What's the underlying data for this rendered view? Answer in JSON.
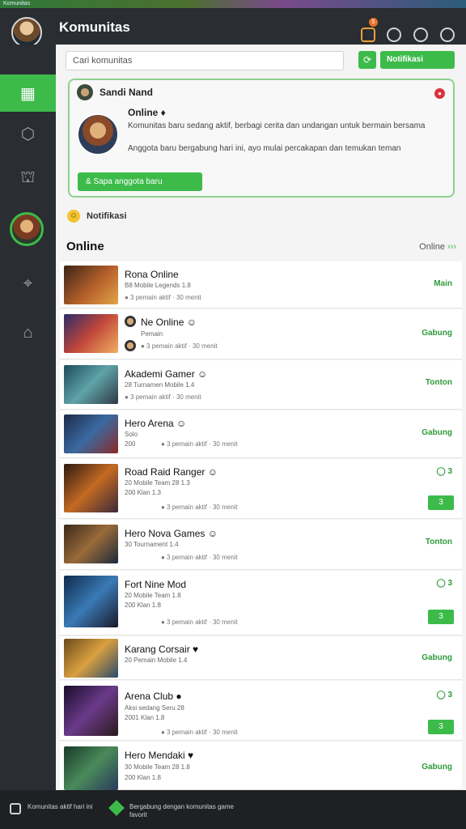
{
  "topbar": {
    "label": "Komunitas"
  },
  "header": {
    "title": "Komunitas",
    "notif_count": "5",
    "icons": [
      "notification-icon",
      "clock-icon",
      "chat-icon",
      "settings-icon"
    ]
  },
  "sidebar": {
    "items": [
      {
        "icon": "grid-icon",
        "glyph": "▦"
      },
      {
        "icon": "shield-icon",
        "glyph": "⬡"
      },
      {
        "icon": "map-icon",
        "glyph": "⛫"
      },
      {
        "icon": "avatar",
        "glyph": ""
      },
      {
        "icon": "crosshair-icon",
        "glyph": "⌖"
      },
      {
        "icon": "home-icon",
        "glyph": "⌂"
      }
    ]
  },
  "search": {
    "value": "Cari komunitas"
  },
  "buttons": {
    "refresh_glyph": "⟳",
    "notif_label": "Notifikasi"
  },
  "profile_card": {
    "name": "Sandi Nand",
    "status": "Online ♦",
    "text1": "Komunitas baru sedang aktif, berbagi cerita dan undangan untuk bermain bersama",
    "text2": "Anggota baru bergabung hari ini, ayo mulai percakapan dan temukan teman",
    "action": "& Sapa anggota baru",
    "close": "●"
  },
  "notice": {
    "emoji": "☺",
    "text": "Notifikasi"
  },
  "section": {
    "title": "Online",
    "link": "Online",
    "link_arrow": "›››"
  },
  "games": [
    {
      "title": "Rona Online",
      "line1": "B8 Mobile Legends 1.8",
      "line2": "",
      "meta": "● 3 pemain aktif · 30 menit",
      "value": "Main",
      "badge": ""
    },
    {
      "title": "Ne Online ☺",
      "line1": "Pemain",
      "line2": "",
      "meta": "● 3 pemain aktif · 30 menit",
      "value": "Gabung",
      "badge": ""
    },
    {
      "title": "Akademi Gamer ☺",
      "line1": "28 Turnamen Mobile 1.4",
      "line2": "",
      "meta": "● 3 pemain aktif · 30 menit",
      "value": "Tonton",
      "badge": ""
    },
    {
      "title": "Hero Arena ☺",
      "line1": "Solo",
      "line2": "200",
      "meta": "● 3 pemain aktif · 30 menit",
      "value": "Gabung",
      "badge": ""
    },
    {
      "title": "Road Raid Ranger ☺",
      "line1": "20 Mobile Team 28 1.3",
      "line2": "200 Klan 1.3",
      "meta": "● 3 pemain aktif · 30 menit",
      "value": "◯ 3",
      "badge": "3"
    },
    {
      "title": "Hero Nova Games ☺",
      "line1": "30 Tournament 1.4",
      "line2": "",
      "meta": "● 3 pemain aktif · 30 menit",
      "value": "Tonton",
      "badge": ""
    },
    {
      "title": "Fort Nine Mod",
      "line1": "20 Mobile Team 1.8",
      "line2": "200 Klan 1.8",
      "meta": "● 3 pemain aktif · 30 menit",
      "value": "◯ 3",
      "badge": "3"
    },
    {
      "title": "Karang Corsair ♥",
      "line1": "20 Pemain Mobile 1.4",
      "line2": "",
      "meta": "",
      "value": "Gabung",
      "badge": ""
    },
    {
      "title": "Arena Club ●",
      "line1": "Aksi sedang Seru 28",
      "line2": "2001 Klan 1.8",
      "meta": "● 3 pemain aktif · 30 menit",
      "value": "◯ 3",
      "badge": "3"
    },
    {
      "title": "Hero Mendaki ♥",
      "line1": "30 Mobile Team 28 1.8",
      "line2": "200 Klan 1.8",
      "meta": "",
      "value": "Gabung",
      "badge": ""
    }
  ],
  "footer": {
    "text1": "Komunitas aktif hari ini",
    "text2": "Bergabung dengan komunitas game favorit"
  }
}
